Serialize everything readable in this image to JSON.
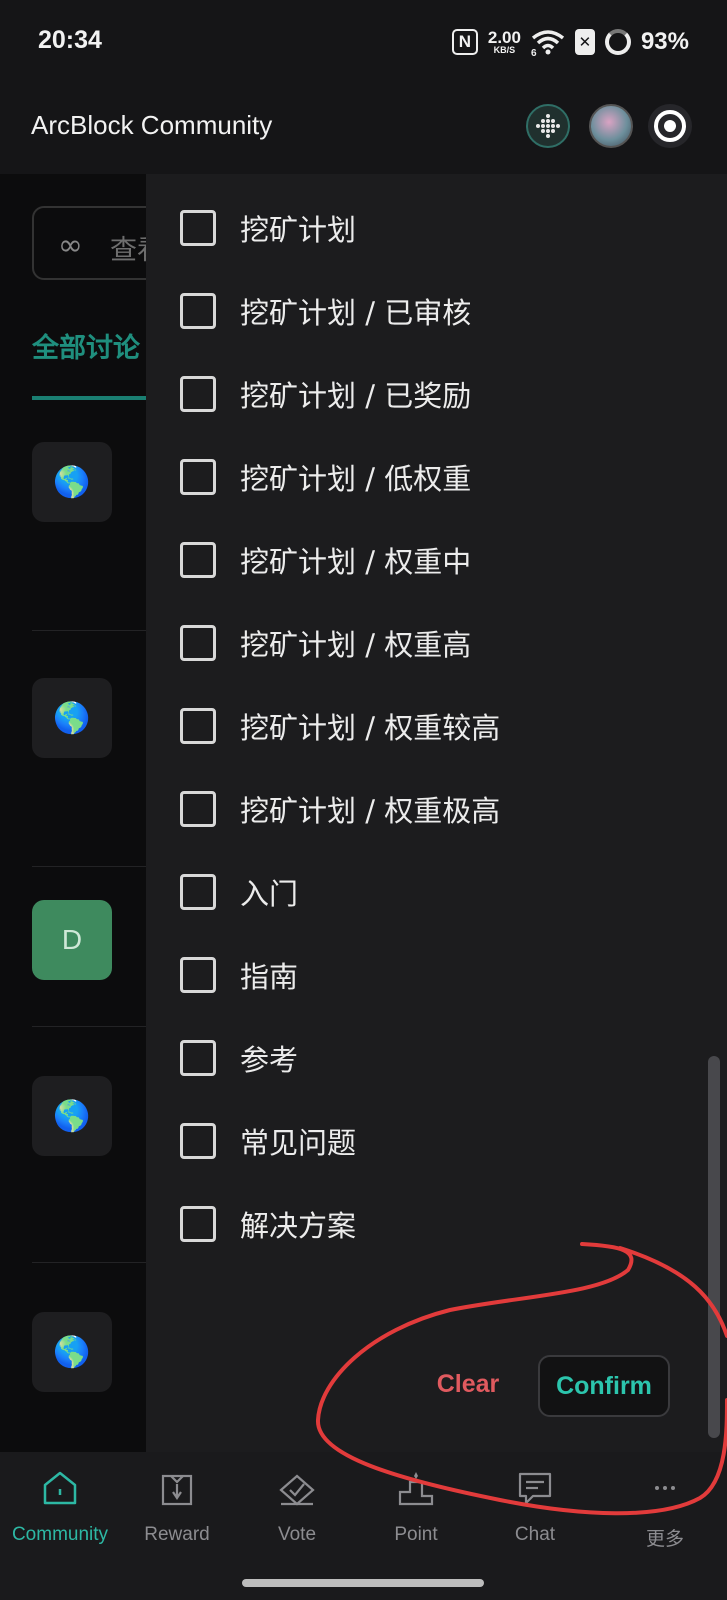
{
  "status_bar": {
    "time": "20:34",
    "nfc": "N",
    "net_speed": "2.00",
    "net_unit": "KB/S",
    "wifi_gen": "6",
    "sim_icon": "✕",
    "battery": "93%"
  },
  "header": {
    "title": "ArcBlock Community"
  },
  "background_page": {
    "search_placeholder": "查看",
    "active_tab": "全部讨论",
    "post_avatars": [
      "🌎",
      "🌎",
      "D",
      "🌎",
      "🌎"
    ]
  },
  "filter_drawer": {
    "options": [
      {
        "label": "挖矿计划",
        "checked": false
      },
      {
        "label": "挖矿计划 / 已审核",
        "checked": false
      },
      {
        "label": "挖矿计划 / 已奖励",
        "checked": false
      },
      {
        "label": "挖矿计划 / 低权重",
        "checked": false
      },
      {
        "label": "挖矿计划 / 权重中",
        "checked": false
      },
      {
        "label": "挖矿计划 / 权重高",
        "checked": false
      },
      {
        "label": "挖矿计划 / 权重较高",
        "checked": false
      },
      {
        "label": "挖矿计划 / 权重极高",
        "checked": false
      },
      {
        "label": "入门",
        "checked": false
      },
      {
        "label": "指南",
        "checked": false
      },
      {
        "label": "参考",
        "checked": false
      },
      {
        "label": "常见问题",
        "checked": false
      },
      {
        "label": "解决方案",
        "checked": false
      }
    ],
    "clear_label": "Clear",
    "confirm_label": "Confirm"
  },
  "bottom_nav": {
    "items": [
      {
        "label": "Community",
        "icon": "home-icon",
        "active": true
      },
      {
        "label": "Reward",
        "icon": "gift-icon",
        "active": false
      },
      {
        "label": "Vote",
        "icon": "vote-icon",
        "active": false
      },
      {
        "label": "Point",
        "icon": "podium-icon",
        "active": false
      },
      {
        "label": "Chat",
        "icon": "chat-icon",
        "active": false
      },
      {
        "label": "更多",
        "icon": "more-icon",
        "active": false
      }
    ]
  },
  "colors": {
    "accent": "#2db8a4",
    "clear": "#e05a5f",
    "annotation": "#e23b3b"
  }
}
